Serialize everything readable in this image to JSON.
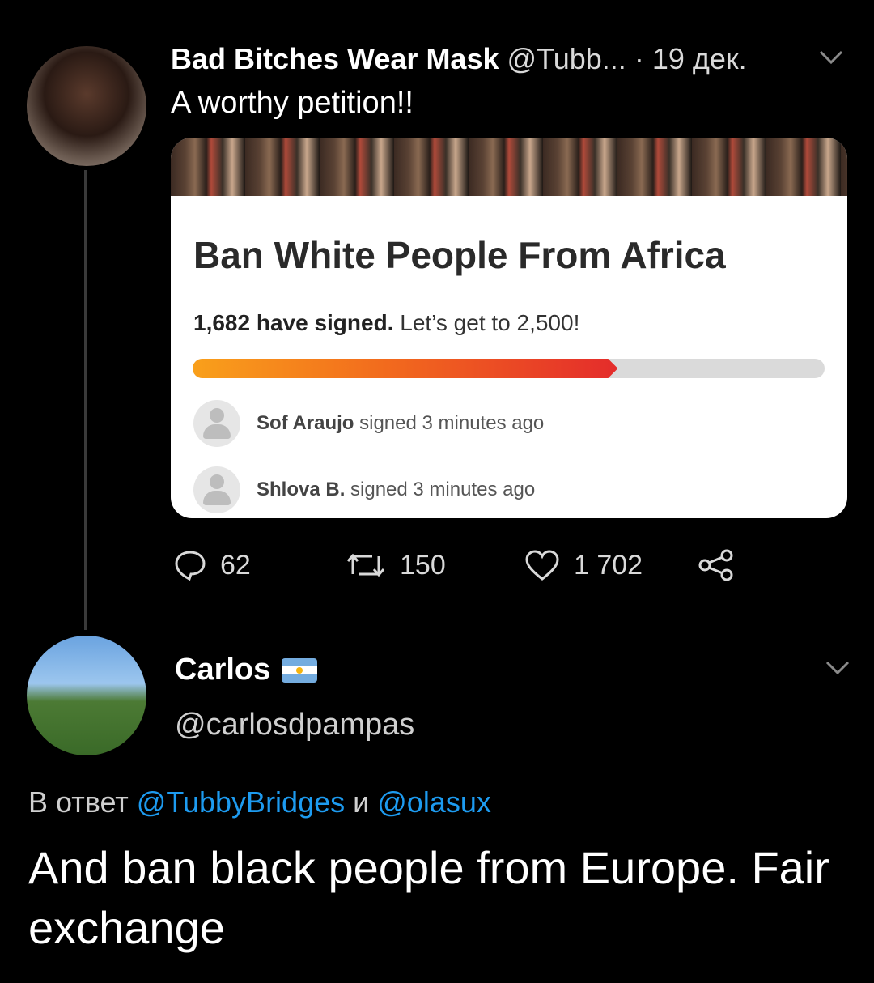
{
  "tweet1": {
    "author_name": "Bad Bitches Wear Mask",
    "handle": "@Tubb...",
    "separator": "·",
    "date": "19 дек.",
    "text": "A worthy petition!!",
    "petition": {
      "title": "Ban White People From Africa",
      "signed_bold": "1,682 have signed.",
      "goal_text": "Let’s get to 2,500!",
      "progress_fraction": 0.6728,
      "signers": [
        {
          "name": "Sof Araujo",
          "action": "signed 3 minutes ago"
        },
        {
          "name": "Shlova B.",
          "action": "signed 3 minutes ago"
        }
      ]
    },
    "actions": {
      "replies": "62",
      "retweets": "150",
      "likes": "1 702"
    }
  },
  "tweet2": {
    "author_name": "Carlos",
    "handle": "@carlosdpampas",
    "reply_prefix": "В ответ",
    "reply_mention1": "@TubbyBridges",
    "reply_conj": "и",
    "reply_mention2": "@olasux",
    "text": "And ban black people from Europe. Fair exchange"
  },
  "icons": {
    "reply": "speech-bubble-icon",
    "retweet": "retweet-arrows-icon",
    "like": "heart-icon",
    "share": "share-nodes-icon",
    "menu": "chevron-down-icon",
    "flag": "argentina-flag-icon"
  },
  "colors": {
    "background": "#000000",
    "link": "#1d9bf0",
    "progress_start": "#f9a01b",
    "progress_end": "#e42c2b"
  }
}
